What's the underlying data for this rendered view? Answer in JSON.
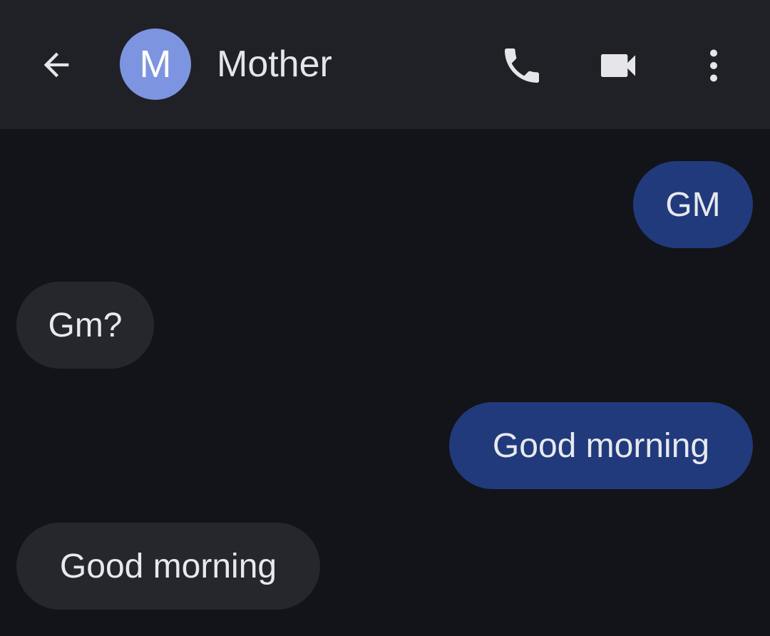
{
  "header": {
    "avatar_initial": "M",
    "contact_name": "Mother",
    "icons": {
      "back": "arrow-back-icon",
      "call": "phone-icon",
      "video": "video-camera-icon",
      "more": "more-vertical-icon"
    }
  },
  "messages": [
    {
      "direction": "outgoing",
      "text": "GM"
    },
    {
      "direction": "incoming",
      "text": "Gm?"
    },
    {
      "direction": "outgoing",
      "text": "Good morning"
    },
    {
      "direction": "incoming",
      "text": "Good morning"
    }
  ],
  "colors": {
    "background": "#131419",
    "header_background": "#202127",
    "avatar": "#7d95e0",
    "outgoing_bubble": "#213a7c",
    "incoming_bubble": "#26272d",
    "text": "#e8e9ee"
  }
}
